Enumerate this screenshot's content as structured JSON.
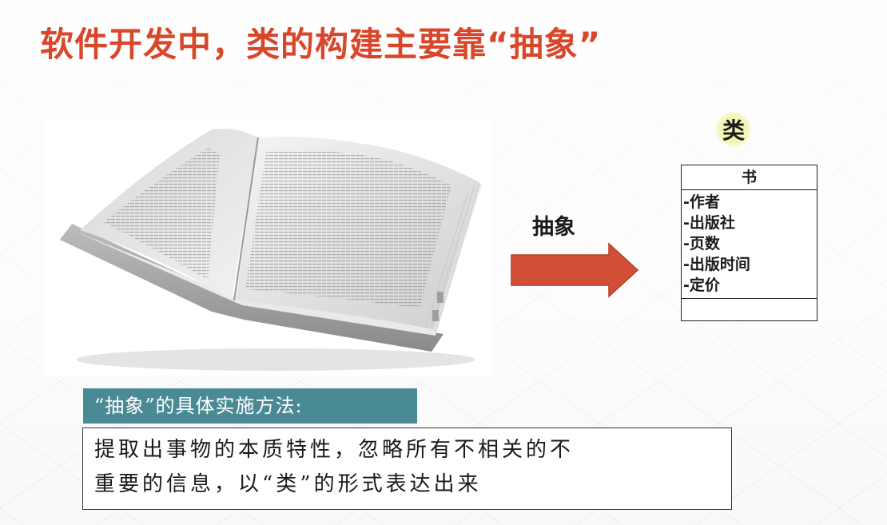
{
  "slide": {
    "title": "软件开发中，类的构建主要靠“抽象”",
    "arrow_label": "抽象",
    "class_label": "类",
    "colors": {
      "title": "#d9472b",
      "arrow": "#d24f37",
      "method_header_bg": "#4a8a95",
      "class_highlight": "#f6f6a8"
    }
  },
  "uml_class": {
    "name": "书",
    "attributes": [
      "-作者",
      "-出版社",
      "-页数",
      "-出版时间",
      "-定价"
    ]
  },
  "method": {
    "header": "“抽象”的具体实施方法:",
    "line1": "提取出事物的本质特性，忽略所有不相关的不",
    "line2": "重要的信息，以“类”的形式表达出来"
  },
  "image": {
    "description_icon": "open-book-image"
  }
}
